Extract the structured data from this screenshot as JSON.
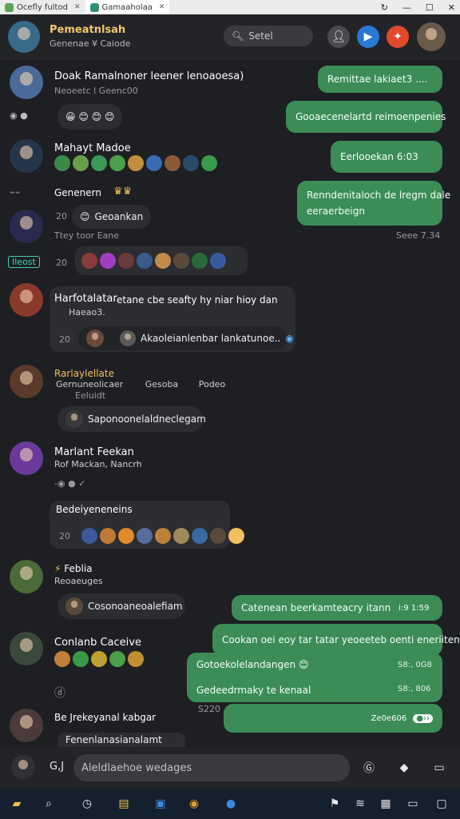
{
  "tabs": [
    {
      "label": "Ocefly fultod",
      "color": "#5aa45a"
    },
    {
      "label": "Gamaaholaa",
      "color": "#2f8f7a"
    }
  ],
  "window": {
    "min": "—",
    "max": "☐",
    "close": "✕",
    "refresh": "↻"
  },
  "header": {
    "title": "Pemeatnlsah",
    "subtitle": "Genenae ¥ Caiode",
    "search_placeholder": "Setel",
    "icons": [
      "person-icon",
      "video-icon",
      "notification-icon"
    ],
    "colors": {
      "gray": "#4a4b50",
      "blue": "#2a78d6",
      "red": "#e04a2a"
    }
  },
  "messages": {
    "m1": {
      "name": "Doak Ramalnoner leener lenoaoesa)",
      "meta": "Neoeetc l Geenc00",
      "emojis": "😀 😊 😊 😊"
    },
    "m2": {
      "name": "Mahayt Madoe"
    },
    "m3": {
      "name": "Genenern",
      "crown": "♛♛"
    },
    "m4": {
      "num": "20",
      "pill": "Geoankan",
      "meta": "Ttey toor Eane"
    },
    "m5": {
      "tag": "Ileost",
      "num": "20"
    },
    "m6": {
      "name": "Harfotalatar",
      "text": "etane cbe seafty hy niar hioy dan",
      "sub": "Haeao3.",
      "num": "20",
      "card_text": "Akaoleianlenbar lankatunoe.."
    },
    "m7": {
      "name": "Rarlaylellate",
      "sub1": "Gernuneolicaer",
      "sub1b": "Gesoba",
      "sub1c": "Podeo",
      "sub2": "Eeluidt",
      "pill": "Saponoonelaldneclegam"
    },
    "m8": {
      "name": "Marlant Feekan",
      "sub": "Rof Mackan, Nancrh",
      "card_title": "Bedeiyeneneins",
      "num": "20"
    },
    "m9": {
      "name": "Feblia",
      "sub": "Reoaeuges",
      "pill": "Cosonoaneoalefiam"
    },
    "m10": {
      "name": "Conlanb Caceive",
      "icon": "ⓓ"
    },
    "m11": {
      "name": "Be Jrekeyanal kabgar",
      "pill": "Fenenlanasianalamt"
    }
  },
  "outgoing": [
    {
      "text": "Remittae lakiaet3 ...."
    },
    {
      "text": "Gooaecenelartd reimoenpenies"
    },
    {
      "text": "Eerlooekan 6:03"
    },
    {
      "text": "Renndenitaloch de lregm dale",
      "text2": "eeraerbeign",
      "stamp": "Seee 7.34"
    },
    {
      "text": "Catenean beerkamteacry itann",
      "stamp": "i:9 1:59"
    },
    {
      "text": "Cookan oei eoy tar tatar yeoeeteb oenti eneriiten",
      "line2": "Gotoekolelandangen 😊",
      "stamp2": "S8:, 0G8",
      "line3": "Gedeedrmaky te kenaal",
      "stamp3": "S8:, 806",
      "stamp_left": "S220",
      "stamp4": "Ze0e606"
    }
  ],
  "composer": {
    "placeholder": "Aleldlaehoe wedages",
    "left_label": "G,J"
  },
  "taskbar_icons": [
    "folder-icon",
    "search-icon",
    "clock-icon",
    "store-icon",
    "app-icon",
    "browser-icon",
    "shield-icon",
    "flag-icon",
    "wifi-icon",
    "keyboard-icon",
    "monitor-icon",
    "chat-icon"
  ]
}
